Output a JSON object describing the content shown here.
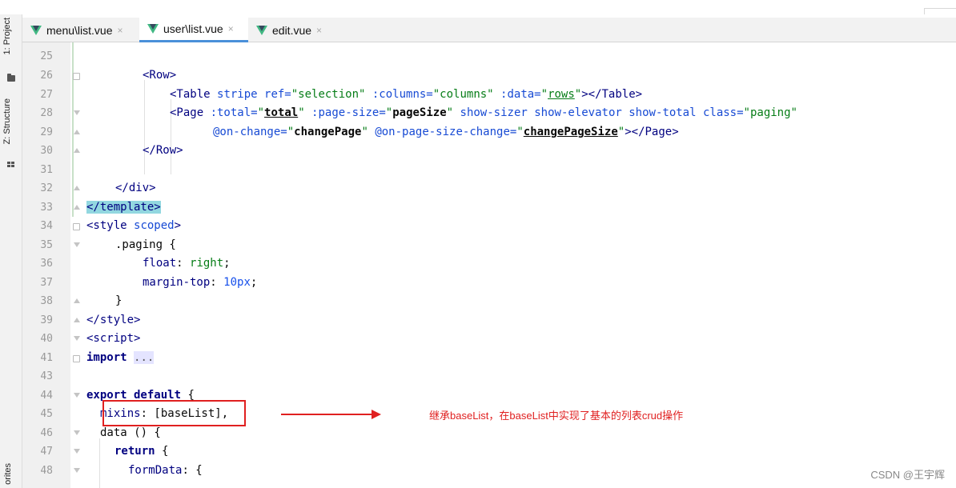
{
  "left_rail": {
    "project_label": "1: Project",
    "structure_label": "Z: Structure",
    "favorites_label": "orites"
  },
  "tabs": [
    {
      "label": "menu\\list.vue",
      "icon": "vue-icon",
      "active": false
    },
    {
      "label": "user\\list.vue",
      "icon": "vue-icon",
      "active": true
    },
    {
      "label": "edit.vue",
      "icon": "vue-icon",
      "active": false
    }
  ],
  "tab_close_glyph": "×",
  "editor": {
    "lines": [
      {
        "n": "25"
      },
      {
        "n": "26"
      },
      {
        "n": "27"
      },
      {
        "n": "28"
      },
      {
        "n": "29"
      },
      {
        "n": "30"
      },
      {
        "n": "31"
      },
      {
        "n": "32"
      },
      {
        "n": "33"
      },
      {
        "n": "34"
      },
      {
        "n": "35"
      },
      {
        "n": "36"
      },
      {
        "n": "37"
      },
      {
        "n": "38"
      },
      {
        "n": "39"
      },
      {
        "n": "40"
      },
      {
        "n": "41"
      },
      {
        "n": "43"
      },
      {
        "n": "44"
      },
      {
        "n": "45"
      },
      {
        "n": "46"
      },
      {
        "n": "47"
      },
      {
        "n": "48"
      }
    ],
    "code": {
      "l26_tag": "<Row>",
      "l27_open": "<Table ",
      "l27_a1": "stripe ref=",
      "l27_s1": "\"selection\"",
      "l27_a2": " :columns=",
      "l27_s2": "\"columns\"",
      "l27_a3": " :data=",
      "l27_q1": "\"",
      "l27_s3": "rows",
      "l27_q2": "\"",
      "l27_close": "></Table>",
      "l28_open": "<Page ",
      "l28_a1": ":total=",
      "l28_q1": "\"",
      "l28_s1": "total",
      "l28_q2": "\"",
      "l28_a2": " :page-size=",
      "l28_q3": "\"",
      "l28_s2": "pageSize",
      "l28_q4": "\"",
      "l28_a3": " show-sizer show-elevator show-total class=",
      "l28_s3": "\"paging\"",
      "l29_a1": "@on-change=",
      "l29_q1": "\"",
      "l29_s1": "changePage",
      "l29_q2": "\"",
      "l29_a2": " @on-page-size-change=",
      "l29_q3": "\"",
      "l29_s2": "changePageSize",
      "l29_q4": "\"",
      "l29_close": "></Page>",
      "l30_tag": "</Row>",
      "l32_tag": "</div>",
      "l33_tag": "</template>",
      "l34_open": "<style ",
      "l34_attr": "scoped",
      "l34_close": ">",
      "l35": ".paging {",
      "l36_prop": "float",
      "l36_colon": ": ",
      "l36_val": "right",
      "l36_semi": ";",
      "l37_prop": "margin-top",
      "l37_colon": ": ",
      "l37_val": "10px",
      "l37_semi": ";",
      "l38": "}",
      "l39_tag": "</style>",
      "l40_tag": "<script>",
      "l41_kw": "import",
      "l41_dots": "...",
      "l44_kw": "export default",
      "l44_brace": " {",
      "l45_prop": "mixins",
      "l45_rest": ": [baseList],",
      "l46": "data () {",
      "l47_kw": "return",
      "l47_brace": " {",
      "l48_prop": "formData",
      "l48_rest": ": {"
    }
  },
  "annotation": {
    "text": "继承baseList，在baseList中实现了基本的列表crud操作"
  },
  "watermark": "CSDN @王宇辉",
  "colors": {
    "tag": "#000080",
    "attr": "#174ad4",
    "string": "#067d17",
    "annotation_red": "#e02020",
    "active_tab_underline": "#4a90d9",
    "vue_green": "#41b883"
  }
}
